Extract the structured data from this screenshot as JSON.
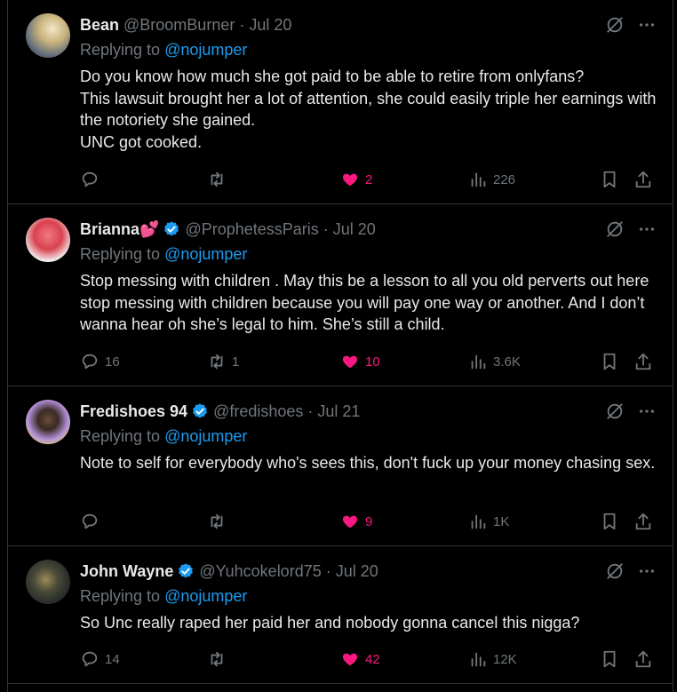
{
  "tweets": [
    {
      "name": "Bean",
      "verified": false,
      "handle": "@BroomBurner",
      "date": "Jul 20",
      "replying_label": "Replying to",
      "replying_handle": "@nojumper",
      "text": "Do you know how much she got paid to be able to retire from onlyfans?\nThis lawsuit brought her a lot of attention, she could easily triple her earnings with the notoriety she gained.\nUNC got cooked.",
      "replies": "",
      "retweets": "",
      "likes": "2",
      "views": "226"
    },
    {
      "name": "Brianna💕",
      "verified": true,
      "handle": "@ProphetessParis",
      "date": "Jul 20",
      "replying_label": "Replying to",
      "replying_handle": "@nojumper",
      "text": "Stop messing with children . May this be a lesson to all you old perverts out here stop messing with children because you will pay one way or another. And I don’t wanna hear oh she’s legal to him. She’s still a child.",
      "replies": "16",
      "retweets": "1",
      "likes": "10",
      "views": "3.6K"
    },
    {
      "name": "Fredishoes 94",
      "verified": true,
      "handle": "@fredishoes",
      "date": "Jul 21",
      "replying_label": "Replying to",
      "replying_handle": "@nojumper",
      "text": "Note to self for everybody who's sees this, don't fuck up your money chasing sex.",
      "replies": "",
      "retweets": "",
      "likes": "9",
      "views": "1K"
    },
    {
      "name": "John Wayne",
      "verified": true,
      "handle": "@Yuhcokelord75",
      "date": "Jul 20",
      "replying_label": "Replying to",
      "replying_handle": "@nojumper",
      "text": "So Unc really raped her paid her and nobody gonna cancel this nigga?",
      "replies": "14",
      "retweets": "",
      "likes": "42",
      "views": "12K"
    }
  ],
  "colors": {
    "accent": "#1d9bf0",
    "like": "#f91880",
    "muted": "#71767b",
    "text": "#e7e9ea",
    "border": "#2f3336"
  },
  "icons": [
    "grok-icon",
    "more-icon",
    "reply-icon",
    "retweet-icon",
    "heart-icon",
    "views-icon",
    "bookmark-icon",
    "share-icon",
    "verified-icon"
  ]
}
